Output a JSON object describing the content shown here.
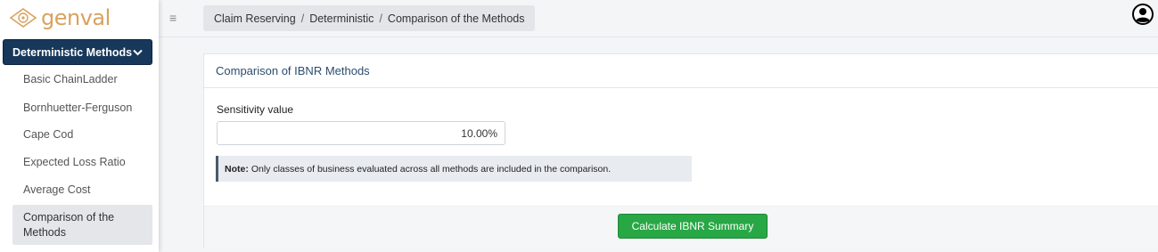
{
  "brand": {
    "name": "genval",
    "color": "#d9a25f"
  },
  "topbar": {
    "menu_icon": "hamburger-icon",
    "breadcrumb": [
      "Claim Reserving",
      "Deterministic",
      "Comparison of the Methods"
    ],
    "user_icon": "user-circle-icon"
  },
  "sidebar": {
    "section": {
      "label": "Deterministic Methods",
      "icon": "chevron-down-icon",
      "color": "#17385a"
    },
    "items": [
      {
        "label": "Basic ChainLadder",
        "active": false
      },
      {
        "label": "Bornhuetter-Ferguson",
        "active": false
      },
      {
        "label": "Cape Cod",
        "active": false
      },
      {
        "label": "Expected Loss Ratio",
        "active": false
      },
      {
        "label": "Average Cost",
        "active": false
      },
      {
        "label_line1": "Comparison of the",
        "label_line2": "Methods",
        "active": true
      }
    ]
  },
  "card": {
    "title": "Comparison of IBNR Methods",
    "sensitivity": {
      "label": "Sensitivity value",
      "value": "10.00%"
    },
    "note": {
      "prefix": "Note:",
      "text": "Only classes of business evaluated across all methods are included in the comparison."
    },
    "button_label": "Calculate IBNR Summary",
    "button_color": "#28a745"
  }
}
